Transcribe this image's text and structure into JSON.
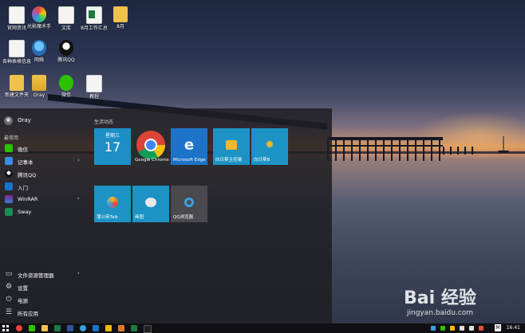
{
  "desktop": {
    "icons": [
      {
        "label": "官网资讯",
        "icon": "document-icon"
      },
      {
        "label": "光影魔术手",
        "icon": "aperture-icon"
      },
      {
        "label": "文库",
        "icon": "document-icon"
      },
      {
        "label": "8月工作汇总",
        "icon": "excel-icon"
      },
      {
        "label": "8月",
        "icon": "folder-icon"
      },
      {
        "label": "各种表格信息",
        "icon": "document-icon"
      },
      {
        "label": "网络",
        "icon": "network-icon"
      },
      {
        "label": "腾讯QQ",
        "icon": "qq-icon"
      },
      {
        "label": "新建文件夹",
        "icon": "folder-icon"
      },
      {
        "label": "Oray",
        "icon": "user-folder-icon"
      },
      {
        "label": "微信",
        "icon": "wechat-icon"
      },
      {
        "label": "教程",
        "icon": "document-icon"
      }
    ]
  },
  "start_menu": {
    "user_name": "Oray",
    "most_used_label": "最常用",
    "apps": [
      {
        "label": "微信",
        "icon": "wechat-icon",
        "color": "#2dc100",
        "has_submenu": false
      },
      {
        "label": "记事本",
        "icon": "notepad-icon",
        "color": "#3a8ee6",
        "has_submenu": true
      },
      {
        "label": "腾讯QQ",
        "icon": "qq-icon",
        "color": "#1c1c1c",
        "has_submenu": false
      },
      {
        "label": "入门",
        "icon": "lightbulb-icon",
        "color": "#1b73c8",
        "has_submenu": false
      },
      {
        "label": "WinRAR",
        "icon": "winrar-icon",
        "color": "#7a2a8c",
        "has_submenu": true
      },
      {
        "label": "Sway",
        "icon": "sway-icon",
        "color": "#1f8a53",
        "has_submenu": false
      }
    ],
    "system": [
      {
        "label": "文件资源管理器",
        "icon": "folder-icon",
        "has_submenu": true
      },
      {
        "label": "设置",
        "icon": "gear-icon",
        "has_submenu": false
      },
      {
        "label": "电源",
        "icon": "power-icon",
        "has_submenu": false
      },
      {
        "label": "所有应用",
        "icon": "list-icon",
        "has_submenu": false
      }
    ],
    "tiles_section_label": "生活动态",
    "tiles": [
      {
        "label": "星期三",
        "sub": "17",
        "kind": "calendar",
        "icon": "calendar-icon",
        "color": "#1e8fc6"
      },
      {
        "label": "Google Chrome",
        "kind": "app",
        "icon": "chrome-icon",
        "color": "#2b2b2e"
      },
      {
        "label": "Microsoft Edge",
        "kind": "app",
        "icon": "edge-icon",
        "color": "#1d73c9"
      },
      {
        "label": "向日葵主控端",
        "kind": "app",
        "icon": "sunflower-remote-icon",
        "color": "#1c93c4"
      },
      {
        "label": "向日葵B",
        "kind": "app",
        "icon": "sunflower-icon",
        "color": "#1c93c4"
      },
      {
        "label": "蒲公英Talk",
        "kind": "app",
        "icon": "dandelion-talk-icon",
        "color": "#1c93c4"
      },
      {
        "label": "画图",
        "kind": "app",
        "icon": "paint-icon",
        "color": "#1c93c4"
      },
      {
        "label": "QQ浏览器",
        "kind": "app",
        "icon": "qq-browser-icon",
        "color": "#4a4a4e"
      }
    ]
  },
  "taskbar": {
    "clock": "16:41",
    "lang": "M",
    "apps": [
      {
        "icon": "chrome-icon",
        "color": "#e8453c"
      },
      {
        "icon": "wechat-icon",
        "color": "#2dc100"
      },
      {
        "icon": "folder-icon",
        "color": "#f0c24b"
      },
      {
        "icon": "excel-icon",
        "color": "#1d7a43"
      },
      {
        "icon": "word-icon",
        "color": "#2b579a"
      },
      {
        "icon": "qq-browser-icon",
        "color": "#3aa0e0"
      },
      {
        "icon": "edge-icon",
        "color": "#1d73c9"
      },
      {
        "icon": "star-icon",
        "color": "#f5b800"
      },
      {
        "icon": "paint-icon",
        "color": "#e07a2a"
      },
      {
        "icon": "excel-icon",
        "color": "#1d7a43"
      },
      {
        "icon": "qq-icon",
        "color": "#222"
      }
    ]
  },
  "watermark": {
    "main": "Bai 经验",
    "sub": "jingyan.baidu.com"
  }
}
